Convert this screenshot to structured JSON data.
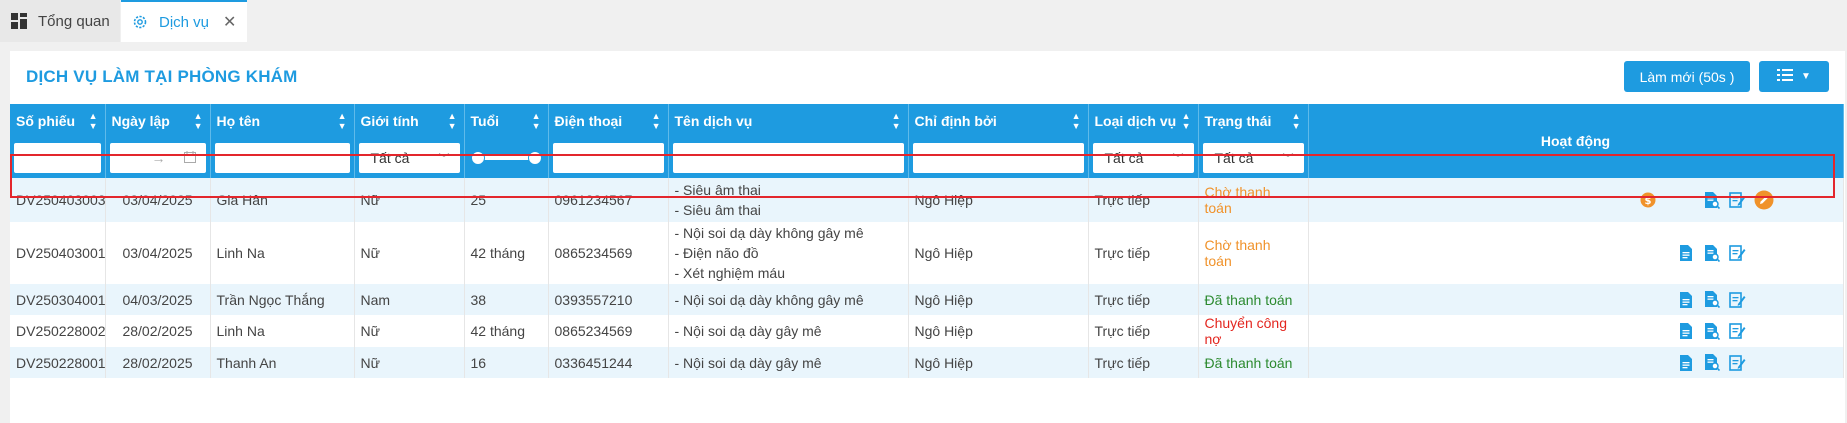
{
  "tabs": [
    {
      "label": "Tổng quan",
      "icon": "dashboard-icon",
      "active": false
    },
    {
      "label": "Dịch vụ",
      "icon": "gear-icon",
      "active": true,
      "closable": true
    }
  ],
  "page": {
    "title": "DỊCH VỤ LÀM TẠI PHÒNG KHÁM",
    "refresh_label": "Làm mới (50s )",
    "menu_icon": "list-menu-icon"
  },
  "table": {
    "columns": [
      "Số phiếu",
      "Ngày lập",
      "Họ tên",
      "Giới tính",
      "Tuổi",
      "Điện thoại",
      "Tên dịch vụ",
      "Chỉ định bởi",
      "Loại dịch vụ",
      "Trạng thái",
      "Hoạt động"
    ],
    "filters": {
      "gender": "Tất cả",
      "service_type": "Tất cả",
      "status": "Tất cả",
      "date_separator": "→"
    },
    "rows": [
      {
        "id": "DV250403003",
        "date": "03/04/2025",
        "name": "Gia Hân",
        "gender": "Nữ",
        "age": "25",
        "phone": "0961234567",
        "services": [
          "- Siêu âm thai",
          "- Siêu âm thai"
        ],
        "by": "Ngô Hiệp",
        "type": "Trực tiếp",
        "status": "Chờ thanh toán",
        "status_color": "#f0922a"
      },
      {
        "id": "DV250403001",
        "date": "03/04/2025",
        "name": "Linh Na",
        "gender": "Nữ",
        "age": "42 tháng",
        "phone": "0865234569",
        "services": [
          "- Nội soi dạ dày không gây mê",
          "- Điện não đồ",
          "- Xét nghiệm máu"
        ],
        "by": "Ngô Hiệp",
        "type": "Trực tiếp",
        "status": "Chờ thanh toán",
        "status_color": "#f0922a"
      },
      {
        "id": "DV250304001",
        "date": "04/03/2025",
        "name": "Trần Ngọc Thắng",
        "gender": "Nam",
        "age": "38",
        "phone": "0393557210",
        "services": [
          "- Nội soi dạ dày không gây mê"
        ],
        "by": "Ngô Hiệp",
        "type": "Trực tiếp",
        "status": "Đã thanh toán",
        "status_color": "#2c8a2f"
      },
      {
        "id": "DV250228002",
        "date": "28/02/2025",
        "name": "Linh Na",
        "gender": "Nữ",
        "age": "42 tháng",
        "phone": "0865234569",
        "services": [
          "- Nội soi dạ dày gây mê"
        ],
        "by": "Ngô Hiệp",
        "type": "Trực tiếp",
        "status": "Chuyển công nợ",
        "status_color": "#e3261f"
      },
      {
        "id": "DV250228001",
        "date": "28/02/2025",
        "name": "Thanh An",
        "gender": "Nữ",
        "age": "16",
        "phone": "0336451244",
        "services": [
          "- Nội soi dạ dày gây mê"
        ],
        "by": "Ngô Hiệp",
        "type": "Trực tiếp",
        "status": "Đã thanh toán",
        "status_color": "#2c8a2f"
      }
    ]
  },
  "colors": {
    "accent": "#1e9be0",
    "pending": "#f0922a",
    "paid": "#2c8a2f",
    "debt": "#e3261f",
    "highlight": "#e3262c",
    "row_alt": "#e9f5fc"
  }
}
